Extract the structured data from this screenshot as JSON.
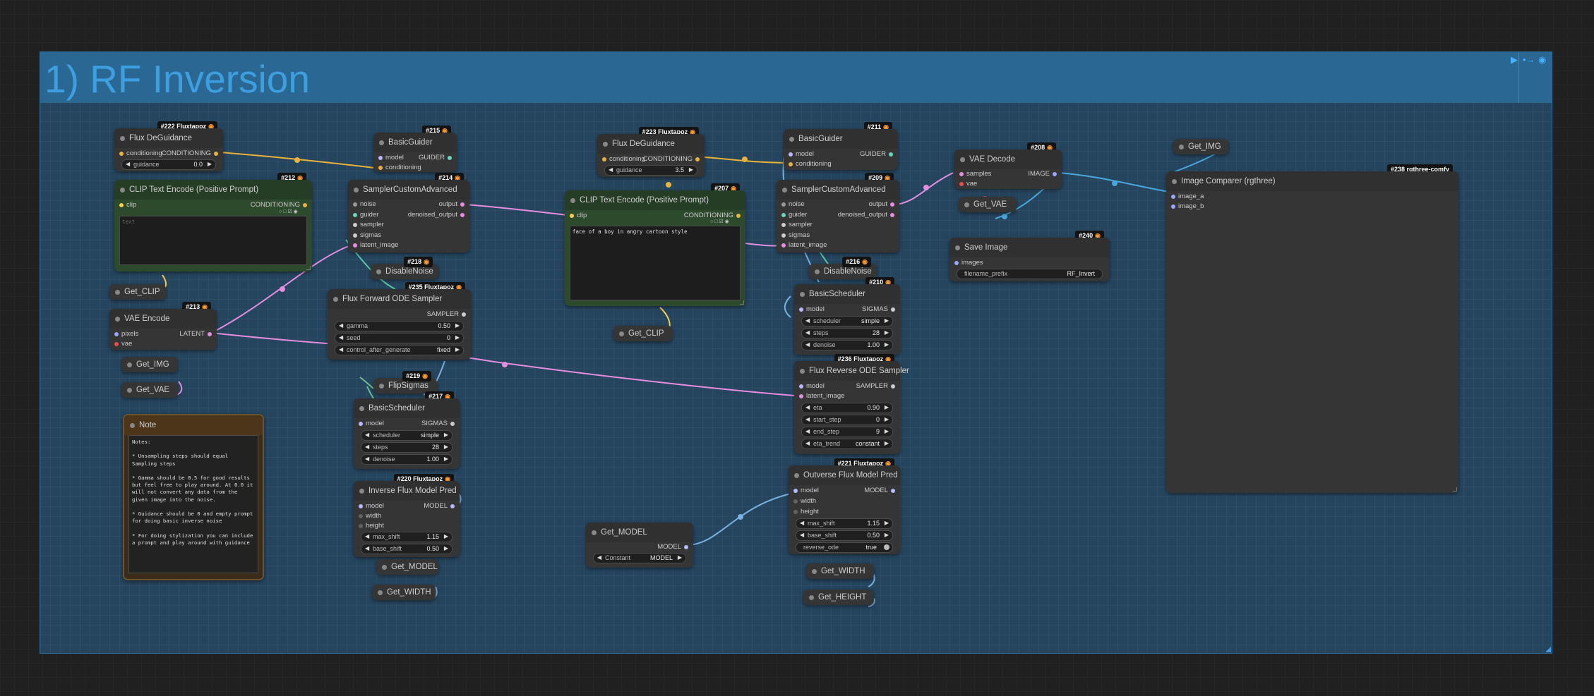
{
  "group": {
    "title": "1) RF Inversion"
  },
  "colors": {
    "group_bg": "#25455f",
    "group_header": "#2a6793",
    "title": "#3d9fe0",
    "wire_conditioning": "#e9b33a",
    "wire_latent": "#e58ee0",
    "wire_model": "#7ab1e0",
    "wire_image": "#4aa8dc",
    "wire_clip": "#f6d047"
  },
  "nodes": {
    "deguidance1": {
      "badge": "#222 Fluxtapoz",
      "title": "Flux DeGuidance",
      "in_conditioning": "conditioning",
      "out_conditioning": "CONDITIONING",
      "w_guidance_label": "guidance",
      "w_guidance_value": "0.0"
    },
    "clip1": {
      "badge": "#212",
      "title": "CLIP Text Encode (Positive Prompt)",
      "in_clip": "clip",
      "out_conditioning": "CONDITIONING",
      "placeholder": "text",
      "text": ""
    },
    "get_clip1": {
      "title": "Get_CLIP"
    },
    "vae_encode": {
      "badge": "#213",
      "title": "VAE Encode",
      "in_pixels": "pixels",
      "in_vae": "vae",
      "out_latent": "LATENT"
    },
    "get_img1": {
      "title": "Get_IMG"
    },
    "get_vae1": {
      "title": "Get_VAE"
    },
    "note": {
      "title": "Note",
      "text": "Notes:\n\n* Unsampling steps should equal Sampling steps\n\n* Gamma should be 0.5 for good results but feel free to play around. At 0.0 it will not convert any data from the given image into the noise.\n\n* Guidance should be 0 and empty prompt for doing basic inverse noise\n\n* For doing stylization you can include a prompt and play around with guidance"
    },
    "guider1": {
      "badge": "#215",
      "title": "BasicGuider",
      "in_model": "model",
      "in_conditioning": "conditioning",
      "out_guider": "GUIDER"
    },
    "sampler1": {
      "badge": "#214",
      "title": "SamplerCustomAdvanced",
      "in_noise": "noise",
      "in_guider": "guider",
      "in_sampler": "sampler",
      "in_sigmas": "sigmas",
      "in_latent": "latent_image",
      "out_output": "output",
      "out_denoised": "denoised_output"
    },
    "disable_noise1": {
      "badge": "#218",
      "title": "DisableNoise"
    },
    "fwd_sampler": {
      "badge": "#235 Fluxtapoz",
      "title": "Flux Forward ODE Sampler",
      "out_sampler": "SAMPLER",
      "w_gamma_label": "gamma",
      "w_gamma_value": "0.50",
      "w_seed_label": "seed",
      "w_seed_value": "0",
      "w_cag_label": "control_after_generate",
      "w_cag_value": "fixed"
    },
    "flip_sigmas": {
      "badge": "#219",
      "title": "FlipSigmas"
    },
    "sched1": {
      "badge": "#217",
      "title": "BasicScheduler",
      "in_model": "model",
      "out_sigmas": "SIGMAS",
      "w_scheduler_label": "scheduler",
      "w_scheduler_value": "simple",
      "w_steps_label": "steps",
      "w_steps_value": "28",
      "w_denoise_label": "denoise",
      "w_denoise_value": "1.00"
    },
    "inv_pred": {
      "badge": "#220 Fluxtapoz",
      "title": "Inverse Flux Model Pred",
      "in_model": "model",
      "in_width": "width",
      "in_height": "height",
      "out_model": "MODEL",
      "w_max_shift_label": "max_shift",
      "w_max_shift_value": "1.15",
      "w_base_shift_label": "base_shift",
      "w_base_shift_value": "0.50"
    },
    "get_model1": {
      "title": "Get_MODEL"
    },
    "get_width1": {
      "title": "Get_WIDTH"
    },
    "deguidance2": {
      "badge": "#223 Fluxtapoz",
      "title": "Flux DeGuidance",
      "in_conditioning": "conditioning",
      "out_conditioning": "CONDITIONING",
      "w_guidance_label": "guidance",
      "w_guidance_value": "3.5"
    },
    "clip2": {
      "badge": "#207",
      "title": "CLIP Text Encode (Positive Prompt)",
      "in_clip": "clip",
      "out_conditioning": "CONDITIONING",
      "text": "face of a boy in angry cartoon style"
    },
    "get_clip2": {
      "title": "Get_CLIP"
    },
    "get_model2": {
      "title": "Get_MODEL",
      "out_model": "MODEL",
      "w_constant_label": "Constant",
      "w_constant_value": "MODEL"
    },
    "guider2": {
      "badge": "#211",
      "title": "BasicGuider",
      "in_model": "model",
      "in_conditioning": "conditioning",
      "out_guider": "GUIDER"
    },
    "sampler2": {
      "badge": "#209",
      "title": "SamplerCustomAdvanced",
      "in_noise": "noise",
      "in_guider": "guider",
      "in_sampler": "sampler",
      "in_sigmas": "sigmas",
      "in_latent": "latent_image",
      "out_output": "output",
      "out_denoised": "denoised_output"
    },
    "disable_noise2": {
      "badge": "#216",
      "title": "DisableNoise"
    },
    "sched2": {
      "badge": "#210",
      "title": "BasicScheduler",
      "in_model": "model",
      "out_sigmas": "SIGMAS",
      "w_scheduler_label": "scheduler",
      "w_scheduler_value": "simple",
      "w_steps_label": "steps",
      "w_steps_value": "28",
      "w_denoise_label": "denoise",
      "w_denoise_value": "1.00"
    },
    "rev_sampler": {
      "badge": "#236 Fluxtapoz",
      "title": "Flux Reverse ODE Sampler",
      "in_model": "model",
      "in_latent": "latent_image",
      "out_sampler": "SAMPLER",
      "w_eta_label": "eta",
      "w_eta_value": "0.90",
      "w_start_label": "start_step",
      "w_start_value": "0",
      "w_end_label": "end_step",
      "w_end_value": "9",
      "w_trend_label": "eta_trend",
      "w_trend_value": "constant"
    },
    "outv_pred": {
      "badge": "#221 Fluxtapoz",
      "title": "Outverse Flux Model Pred",
      "in_model": "model",
      "in_width": "width",
      "in_height": "height",
      "out_model": "MODEL",
      "w_max_shift_label": "max_shift",
      "w_max_shift_value": "1.15",
      "w_base_shift_label": "base_shift",
      "w_base_shift_value": "0.50",
      "w_reverse_label": "reverse_ode",
      "w_reverse_value": "true"
    },
    "get_width2": {
      "title": "Get_WIDTH"
    },
    "get_height2": {
      "title": "Get_HEIGHT"
    },
    "vae_decode": {
      "badge": "#208",
      "title": "VAE Decode",
      "in_samples": "samples",
      "in_vae": "vae",
      "out_image": "IMAGE"
    },
    "get_vae2": {
      "title": "Get_VAE"
    },
    "save_image": {
      "badge": "#240",
      "title": "Save Image",
      "in_images": "images",
      "w_prefix_label": "filename_prefix",
      "w_prefix_value": "RF_Invert"
    },
    "get_img2": {
      "title": "Get_IMG"
    },
    "comparer": {
      "badge": "#238 rgthree-comfy",
      "title": "Image Comparer (rgthree)",
      "in_a": "image_a",
      "in_b": "image_b"
    }
  }
}
